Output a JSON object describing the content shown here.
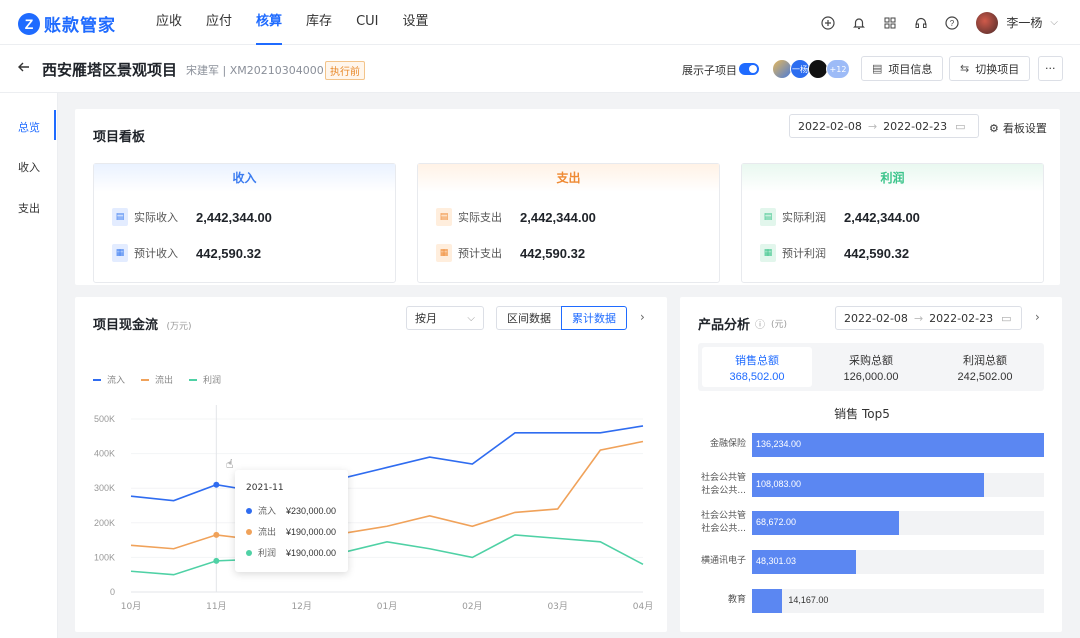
{
  "app": {
    "logo_mark": "Z",
    "logo_text": "账款管家"
  },
  "nav": [
    {
      "label": "应收",
      "active": false
    },
    {
      "label": "应付",
      "active": false
    },
    {
      "label": "核算",
      "active": true
    },
    {
      "label": "库存",
      "active": false
    },
    {
      "label": "CUI",
      "active": false
    },
    {
      "label": "设置",
      "active": false
    }
  ],
  "user": {
    "name": "李一杨"
  },
  "project": {
    "title": "西安雁塔区景观项目",
    "meta": "宋建军 | XM202103040001",
    "status": "执行前",
    "show_sub_label": "展示子项目",
    "show_sub_on": true,
    "member_more": "+12",
    "member_2_label": "一杨",
    "btn_info": "项目信息",
    "btn_switch": "切换项目",
    "btn_more": "···"
  },
  "sidebar": [
    {
      "label": "总览",
      "active": true
    },
    {
      "label": "收入",
      "active": false
    },
    {
      "label": "支出",
      "active": false
    }
  ],
  "board": {
    "title": "项目看板",
    "date_start": "2022-02-08",
    "date_end": "2022-02-23",
    "settings_label": "看板设置",
    "cards": [
      {
        "title": "收入",
        "color": "#3b7cf0",
        "bg": "#eaf2ff",
        "actual_label": "实际收入",
        "actual_value": "2,442,344.00",
        "plan_label": "预计收入",
        "plan_value": "442,590.32"
      },
      {
        "title": "支出",
        "color": "#ef8a33",
        "bg": "#fff2e6",
        "actual_label": "实际支出",
        "actual_value": "2,442,344.00",
        "plan_label": "预计支出",
        "plan_value": "442,590.32"
      },
      {
        "title": "利润",
        "color": "#3cc48b",
        "bg": "#e9f8f0",
        "actual_label": "实际利润",
        "actual_value": "2,442,344.00",
        "plan_label": "预计利润",
        "plan_value": "442,590.32"
      }
    ]
  },
  "cashflow": {
    "title": "项目现金流",
    "unit": "(万元)",
    "period_select": "按月",
    "seg_interval": "区间数据",
    "seg_cumulative": "累计数据",
    "tooltip": {
      "title": "2021-11",
      "rows": [
        {
          "label": "流入",
          "value": "¥230,000.00",
          "color": "#2f6cf0"
        },
        {
          "label": "流出",
          "value": "¥190,000.00",
          "color": "#f0a25a"
        },
        {
          "label": "利润",
          "value": "¥190,000.00",
          "color": "#4fd1a5"
        }
      ]
    }
  },
  "chart_data": {
    "type": "line",
    "x": [
      "10月",
      "",
      "11月",
      "",
      "12月",
      "",
      "01月",
      "",
      "02月",
      "",
      "03月",
      "",
      "04月"
    ],
    "x_tick_labels": [
      "10月",
      "11月",
      "12月",
      "01月",
      "02月",
      "03月",
      "04月"
    ],
    "ylim": [
      0,
      500000
    ],
    "y_ticks": [
      "0",
      "100K",
      "200K",
      "300K",
      "400K",
      "500K"
    ],
    "series": [
      {
        "name": "流入",
        "color": "#2f6cf0",
        "values": [
          277000,
          264000,
          310000,
          290000,
          310000,
          330000,
          360000,
          390000,
          370000,
          460000,
          460000,
          460000,
          480000
        ]
      },
      {
        "name": "流出",
        "color": "#f0a25a",
        "values": [
          135000,
          125000,
          165000,
          150000,
          155000,
          170000,
          190000,
          220000,
          190000,
          230000,
          240000,
          410000,
          435000
        ]
      },
      {
        "name": "利润",
        "color": "#4fd1a5",
        "values": [
          60000,
          50000,
          90000,
          95000,
          100000,
          115000,
          145000,
          125000,
          100000,
          165000,
          155000,
          145000,
          80000
        ]
      }
    ]
  },
  "product": {
    "title": "产品分析",
    "unit": "(元)",
    "date_start": "2022-02-08",
    "date_end": "2022-02-23",
    "tabs": [
      {
        "label": "销售总额",
        "value": "368,502.00",
        "active": true
      },
      {
        "label": "采购总额",
        "value": "126,000.00",
        "active": false
      },
      {
        "label": "利润总额",
        "value": "242,502.00",
        "active": false
      }
    ],
    "top5_title": "销售 Top5",
    "rows": [
      {
        "label": "金融保险",
        "value": 136234.0,
        "text": "136,234.00"
      },
      {
        "label": "社会公共管\n社会公共...",
        "value": 108083.0,
        "text": "108,083.00"
      },
      {
        "label": "社会公共管\n社会公共...",
        "value": 68672.0,
        "text": "68,672.00"
      },
      {
        "label": "横通讯电子",
        "value": 48301.03,
        "text": "48,301.03"
      },
      {
        "label": "教育",
        "value": 14167.0,
        "text": "14,167.00"
      }
    ]
  }
}
